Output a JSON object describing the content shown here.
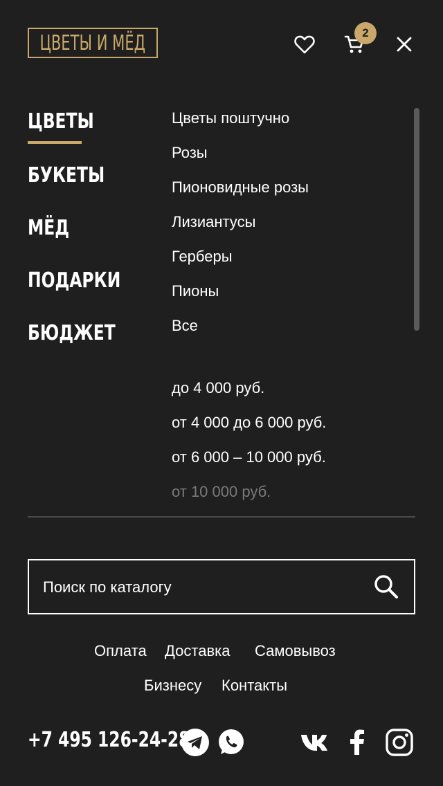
{
  "header": {
    "logo_text": "ЦВЕТЫ И МЁД",
    "cart_count": "2"
  },
  "categories": [
    {
      "label": "ЦВЕТЫ",
      "active": true
    },
    {
      "label": "БУКЕТЫ"
    },
    {
      "label": "МЁД"
    },
    {
      "label": "ПОДАРКИ"
    },
    {
      "label": "БЮДЖЕТ"
    }
  ],
  "submenu": {
    "flowers": [
      "Цветы поштучно",
      "Розы",
      "Пионовидные розы",
      "Лизиантусы",
      "Герберы",
      "Пионы",
      "Все"
    ],
    "budget": [
      "до 4 000 руб.",
      "от 4 000  до 6 000 руб.",
      "от 6 000 – 10 000 руб.",
      "от 10 000 руб."
    ]
  },
  "search": {
    "placeholder": "Поиск по каталогу"
  },
  "footer": {
    "links_row1": [
      "Оплата",
      "Доставка",
      "Самовывоз"
    ],
    "links_row2": [
      "Бизнесу",
      "Контакты"
    ],
    "phone": "+7 495 126-24-28"
  },
  "colors": {
    "background": "#1f1f1f",
    "accent": "#c9a86a",
    "text": "#ffffff"
  },
  "icons": [
    "heart-icon",
    "cart-icon",
    "close-icon",
    "search-icon",
    "telegram-icon",
    "whatsapp-icon",
    "vk-icon",
    "facebook-icon",
    "instagram-icon"
  ]
}
